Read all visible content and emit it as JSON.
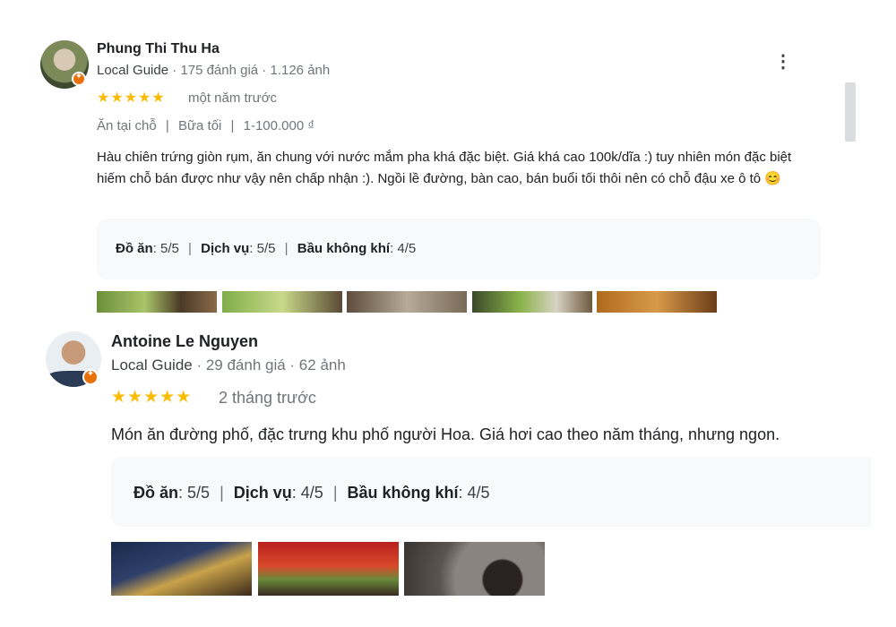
{
  "reviews": [
    {
      "author": "Phung Thi Thu Ha",
      "guide_label": "Local Guide",
      "stats": " · 175 đánh giá · 1.126 ảnh",
      "stars": "★★★★★",
      "rating": 5,
      "time": "một năm trước",
      "tags": [
        "Ăn tại chỗ",
        "Bữa tối",
        "1-100.000 ₫"
      ],
      "text": "Hàu chiên trứng giòn rụm, ăn chung với nước mắm pha khá đặc biệt. Giá khá cao 100k/dĩa :) tuy nhiên món đặc biệt hiếm chỗ bán được như vậy nên chấp nhận :). Ngồi lề đường, bàn cao, bán buổi tối thôi nên có chỗ đậu xe ô tô 😊",
      "sub_ratings": [
        {
          "label": "Đồ ăn",
          "value": ": 5/5"
        },
        {
          "label": "Dịch vụ",
          "value": ": 5/5"
        },
        {
          "label": "Bầu không khí",
          "value": ": 4/5"
        }
      ]
    },
    {
      "author": "Antoine Le Nguyen",
      "guide_label": "Local Guide",
      "stats": " · 29 đánh giá · 62 ảnh",
      "stars": "★★★★★",
      "rating": 5,
      "time": "2 tháng trước",
      "text": "Món ăn đường phố, đặc trưng khu phố người Hoa. Giá hơi cao theo năm tháng, nhưng ngon.",
      "sub_ratings": [
        {
          "label": "Đồ ăn",
          "value": ": 5/5"
        },
        {
          "label": "Dịch vụ",
          "value": ": 4/5"
        },
        {
          "label": "Bầu không khí",
          "value": ": 4/5"
        }
      ]
    }
  ],
  "separator": "|",
  "more_icon": "more-vert-icon"
}
